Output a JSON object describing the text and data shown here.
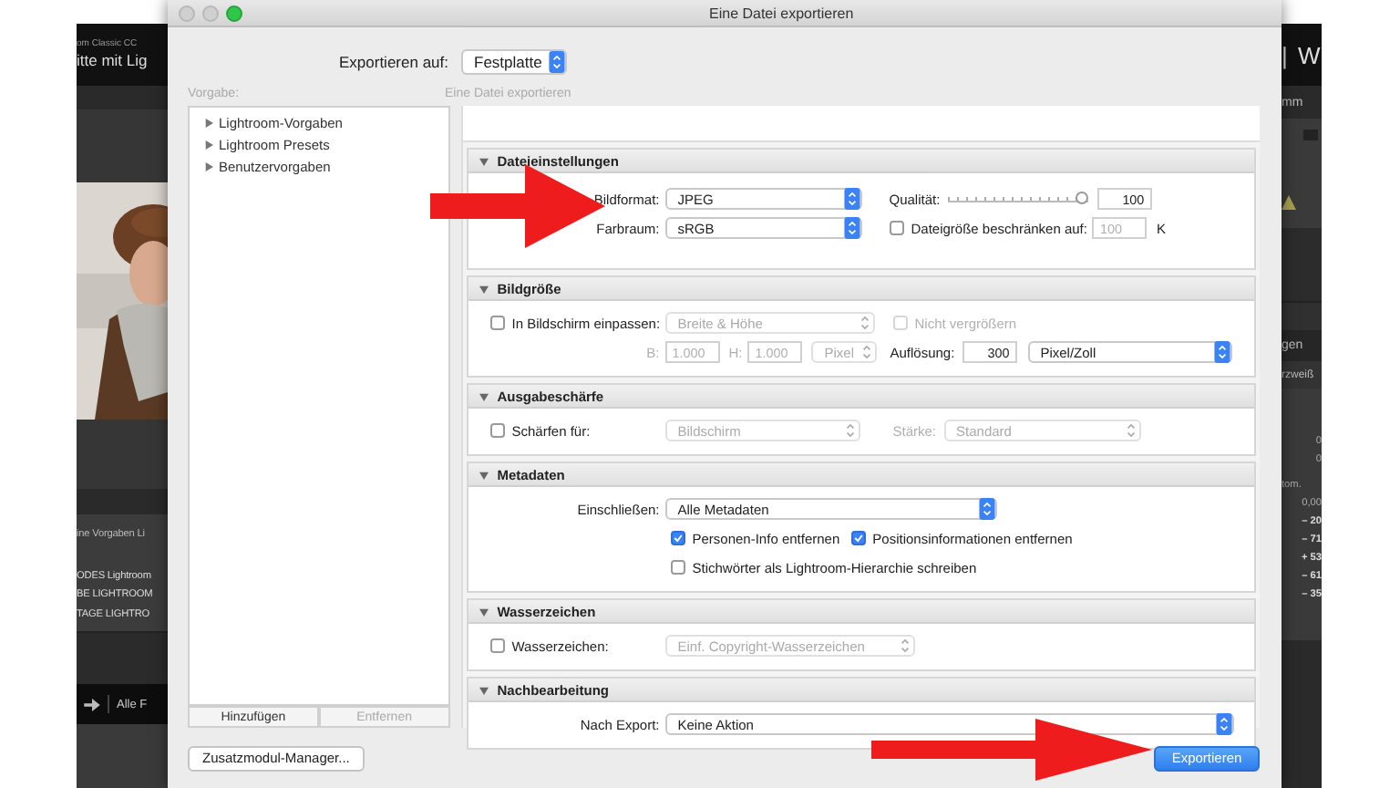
{
  "app_background": {
    "left_panel": {
      "title_small": "om Classic CC",
      "title": "itte mit Lig",
      "presets": [
        "ine Vorgaben Li",
        "ODES Lightroom",
        "BE LIGHTROOM",
        "TAGE LIGHTRO"
      ],
      "nav_label": "Alle F"
    },
    "right_panel": {
      "module": "| W",
      "lens_label": "mm",
      "section_label": "gen",
      "white_balance": "rzweiß",
      "values": [
        "0",
        "0"
      ],
      "subhead": "tom.",
      "numbers": [
        "0,00",
        "– 20",
        "– 71",
        "+ 53",
        "– 61",
        "– 35"
      ]
    }
  },
  "window": {
    "title": "Eine Datei exportieren"
  },
  "export_to": {
    "label": "Exportieren auf:",
    "value": "Festplatte"
  },
  "presets": {
    "label": "Vorgabe:",
    "items": [
      {
        "label": "Lightroom-Vorgaben",
        "expanded": false
      },
      {
        "label": "Lightroom Presets",
        "expanded": false
      },
      {
        "label": "Benutzervorgaben",
        "expanded": false
      }
    ],
    "buttons": [
      {
        "label": "Hinzufügen",
        "disabled": false
      },
      {
        "label": "Entfernen",
        "disabled": true
      }
    ]
  },
  "preset_title": "Eine Datei exportieren",
  "sections": [
    {
      "title": "Dateieinstellungen",
      "expanded": true,
      "rows": [
        {
          "lead": {
            "kind": "label",
            "label": "Bildformat:"
          },
          "controls": [
            {
              "kind": "popup",
              "value": "JPEG",
              "disabled": false
            },
            {
              "kind": "label",
              "label": "Qualität:",
              "disabled": false
            },
            {
              "kind": "slider",
              "level": 1
            },
            {
              "kind": "field",
              "value": "100",
              "disabled": false
            }
          ]
        },
        {
          "lead": {
            "kind": "label",
            "label": "Farbraum:"
          },
          "controls": [
            {
              "kind": "popup",
              "value": "sRGB",
              "disabled": false
            },
            {
              "kind": "checkbox",
              "label": "Dateigröße beschränken auf:",
              "checked": false,
              "disabled": false
            },
            {
              "kind": "field",
              "value": "100",
              "disabled": true
            },
            {
              "kind": "label",
              "label": "K",
              "disabled": false
            }
          ]
        }
      ]
    },
    {
      "title": "Bildgröße",
      "expanded": true,
      "rows": [
        {
          "lead": {
            "kind": "checkbox",
            "label": "In Bildschirm einpassen:",
            "checked": false,
            "disabled": false
          },
          "controls": [
            {
              "kind": "popup",
              "value": "Breite & Höhe",
              "disabled": true
            },
            {
              "kind": "checkbox",
              "label": "Nicht vergrößern",
              "checked": false,
              "disabled": true
            }
          ]
        },
        {
          "lead": {
            "kind": "label",
            "label": "B:",
            "disabled": true
          },
          "controls": [
            {
              "kind": "field",
              "value": "1.000",
              "disabled": true
            },
            {
              "kind": "label",
              "label": "H:",
              "disabled": true
            },
            {
              "kind": "field",
              "value": "1.000",
              "disabled": true
            },
            {
              "kind": "popup",
              "value": "Pixel",
              "disabled": true
            },
            {
              "kind": "label",
              "label": "Auflösung:",
              "disabled": false
            },
            {
              "kind": "field",
              "value": "300",
              "disabled": false
            },
            {
              "kind": "popup",
              "value": "Pixel/Zoll",
              "disabled": false
            }
          ]
        }
      ]
    },
    {
      "title": "Ausgabeschärfe",
      "expanded": true,
      "rows": [
        {
          "lead": {
            "kind": "checkbox",
            "label": "Schärfen für:",
            "checked": false,
            "disabled": false
          },
          "controls": [
            {
              "kind": "popup",
              "value": "Bildschirm",
              "disabled": true
            },
            {
              "kind": "label",
              "label": "Stärke:",
              "disabled": true
            },
            {
              "kind": "popup",
              "value": "Standard",
              "disabled": true
            }
          ]
        }
      ]
    },
    {
      "title": "Metadaten",
      "expanded": true,
      "rows": [
        {
          "lead": {
            "kind": "label",
            "label": "Einschließen:"
          },
          "controls": [
            {
              "kind": "popup",
              "value": "Alle Metadaten",
              "disabled": false
            }
          ]
        },
        {
          "controls": [
            {
              "kind": "checkbox",
              "label": "Personen-Info entfernen",
              "checked": true,
              "disabled": false
            },
            {
              "kind": "checkbox",
              "label": "Positionsinformationen entfernen",
              "checked": true,
              "disabled": false
            }
          ]
        },
        {
          "controls": [
            {
              "kind": "checkbox",
              "label": "Stichwörter als Lightroom-Hierarchie schreiben",
              "checked": false,
              "disabled": false
            }
          ]
        }
      ]
    },
    {
      "title": "Wasserzeichen",
      "expanded": true,
      "rows": [
        {
          "lead": {
            "kind": "checkbox",
            "label": "Wasserzeichen:",
            "checked": false,
            "disabled": false
          },
          "controls": [
            {
              "kind": "popup",
              "value": "Einf. Copyright-Wasserzeichen",
              "disabled": true
            }
          ]
        }
      ]
    },
    {
      "title": "Nachbearbeitung",
      "expanded": true,
      "rows": [
        {
          "lead": {
            "kind": "label",
            "label": "Nach Export:"
          },
          "controls": [
            {
              "kind": "popup",
              "value": "Keine Aktion",
              "disabled": false
            }
          ]
        }
      ]
    }
  ],
  "buttons": [
    {
      "label": "Zusatzmodul-Manager...",
      "kind": "plain"
    },
    {
      "label": "Exportieren",
      "kind": "default"
    }
  ]
}
